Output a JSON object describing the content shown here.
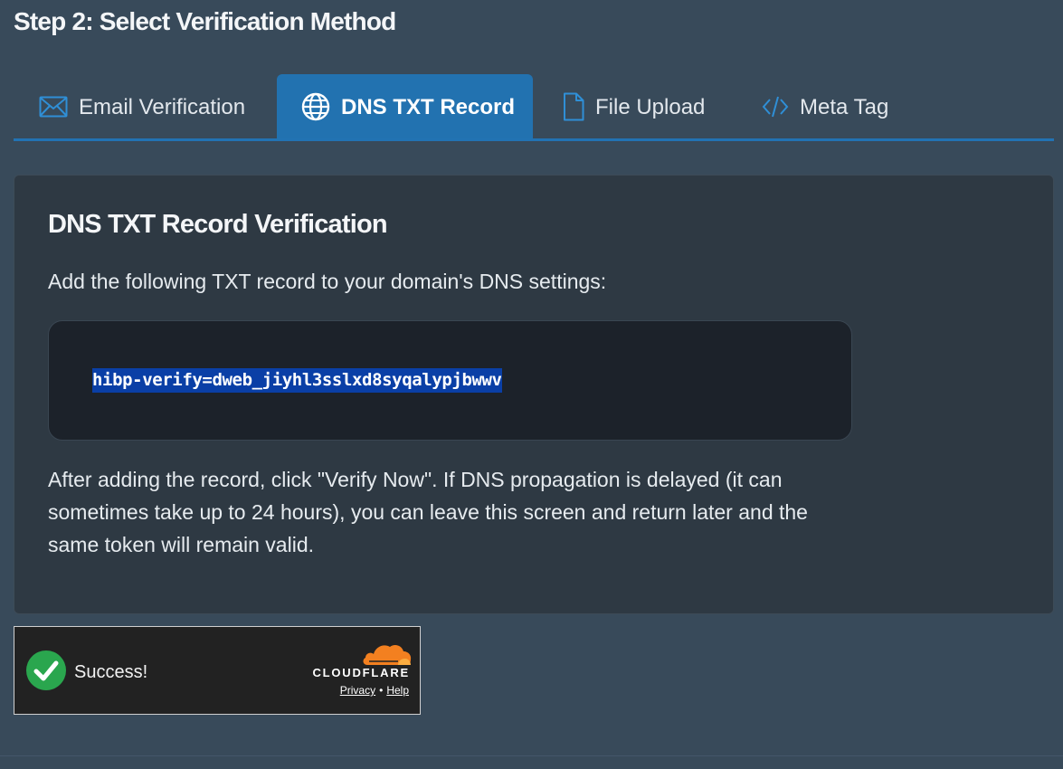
{
  "step": {
    "title": "Step 2: Select Verification Method"
  },
  "tabs": [
    {
      "label": "Email Verification",
      "icon": "envelope-icon",
      "active": false
    },
    {
      "label": "DNS TXT Record",
      "icon": "globe-icon",
      "active": true
    },
    {
      "label": "File Upload",
      "icon": "file-icon",
      "active": false
    },
    {
      "label": "Meta Tag",
      "icon": "code-icon",
      "active": false
    }
  ],
  "panel": {
    "title": "DNS TXT Record Verification",
    "intro": "Add the following TXT record to your domain's DNS settings:",
    "token": "hibp-verify=dweb_jiyhl3sslxd8syqalypjbwwv",
    "after": "After adding the record, click \"Verify Now\". If DNS propagation is delayed (it can sometimes take up to 24 hours), you can leave this screen and return later and the same token will remain valid."
  },
  "captcha": {
    "status": "Success!",
    "brand": "CLOUDFLARE",
    "privacy": "Privacy",
    "separator": "•",
    "help": "Help"
  },
  "colors": {
    "background": "#384a5a",
    "active_tab": "#2272b0",
    "tab_icon": "#2f8fd6",
    "card": "#2e3943",
    "code_box": "#1c222a",
    "token_highlight": "#0a3fa6",
    "success_green": "#2aa64e",
    "cloudflare_orange": "#f38020"
  }
}
